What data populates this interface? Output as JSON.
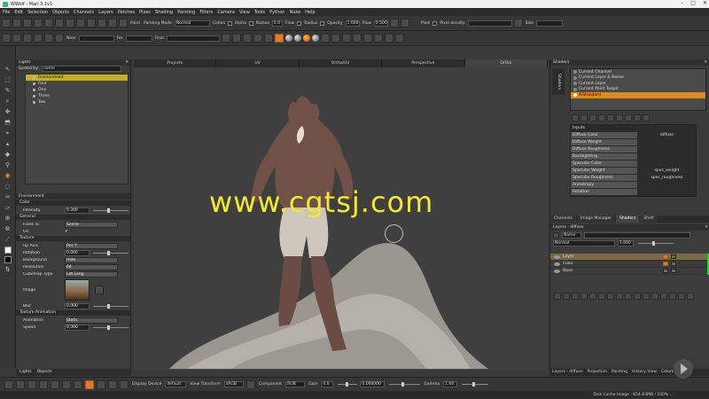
{
  "window": {
    "title": "WWolf - Mari 3.1v1",
    "min": "–",
    "max": "□",
    "close": "✕"
  },
  "menu": [
    "File",
    "Edit",
    "Selection",
    "Objects",
    "Channels",
    "Layers",
    "Patches",
    "Pixes",
    "Shading",
    "Painting",
    "Filters",
    "Camera",
    "View",
    "Tools",
    "Python",
    "Nuke",
    "Help"
  ],
  "toolbar1": {
    "paint": "Paint",
    "painting_mode_label": "Painting Mode",
    "painting_mode": "Normal",
    "colors": "Colors",
    "alpha": "Alpha",
    "radius": "Radius",
    "radius_val": "0.0",
    "flow": "Flow",
    "radius2": "Radius",
    "opacity": "Opacity",
    "opacity_val": "1.000",
    "flow2": "Flow",
    "flow_val": "0.500",
    "pixel": "Pixel",
    "pixel_density": "Pixel density",
    "size": "Size"
  },
  "toolbar2": {
    "near": "Near",
    "far": "Far",
    "final": "Final"
  },
  "lights": {
    "title": "Lights",
    "sorted_by": "Sorted by:",
    "sorted_val": "name",
    "items": [
      "Environment",
      "Four",
      "One",
      "Three",
      "Two"
    ],
    "selected": 0
  },
  "env": {
    "title": "Environment",
    "color_sec": "Color",
    "intensity": "Intensity",
    "intensity_val": "0.300",
    "general_sec": "General",
    "fixed_to": "Fixed To",
    "fixed_val": "Scene",
    "on": "On",
    "texture_sec": "Texture",
    "up_axis": "Up Axis",
    "up_val": "Pos Y",
    "rotation": "Rotation",
    "rotation_val": "0.000",
    "background": "Background",
    "background_val": "Hide",
    "resolution": "Resolution",
    "resolution_val": "64",
    "cubemap": "Cubemap Type",
    "cubemap_val": "Lat-Long",
    "image": "Image",
    "blur": "Blur",
    "blur_val": "0.000",
    "tex_anim_sec": "Texture Animation",
    "animation": "Animation",
    "animation_val": "Static",
    "speed": "Speed",
    "speed_val": "0.000"
  },
  "lefttabs": [
    "Lights",
    "Objects"
  ],
  "viewport": {
    "tabs": [
      "Projects",
      "UV",
      "Ortho/UV",
      "Perspective",
      "Ortho"
    ],
    "active": 4,
    "watermark": "www.cgtsj.com"
  },
  "shaders": {
    "title": "Shaders",
    "side": "Shaders",
    "items": [
      "Current Channel",
      "Current Layer & Below",
      "Current Layer",
      "Current Paint Target",
      "AiStandard"
    ],
    "selected": 4,
    "inputs_sec": "Inputs",
    "rows": [
      [
        "Diffuse Color",
        "diffuse"
      ],
      [
        "Diffuse Weight",
        ""
      ],
      [
        "Diffuse Roughness",
        ""
      ],
      [
        "Backlighting",
        ""
      ],
      [
        "Specular Color",
        ""
      ],
      [
        "Specular Weight",
        "spec_weight"
      ],
      [
        "Specular Roughness",
        "spec_roughness"
      ],
      [
        "Anisotropy",
        ""
      ],
      [
        "Rotation",
        ""
      ]
    ]
  },
  "righttabs": [
    "Channels",
    "Image Manager",
    "Shaders",
    "Shelf"
  ],
  "righttabs_active": 2,
  "layers": {
    "title": "Layers - diffuse",
    "mode": "Normal",
    "opacity": "1.000",
    "name_field": "Name",
    "items": [
      "Layer",
      "Color",
      "Base"
    ],
    "selected": 0
  },
  "rbottomtabs": [
    "Layers - diffuse",
    "Projection",
    "Painting",
    "History View",
    "Colors"
  ],
  "status": {
    "display_device": "Display Device",
    "dd_val": "default",
    "view_transform": "View Transform",
    "vt_val": "sRGB",
    "component": "Component",
    "comp_val": "RGB",
    "gain": "Gain",
    "gain_val": "0.0",
    "fstop": "0.000000",
    "gamma": "Gamma",
    "gamma_val": "1.00"
  },
  "disk": "Disk Cache Usage : 654.63MB / 100% ..."
}
